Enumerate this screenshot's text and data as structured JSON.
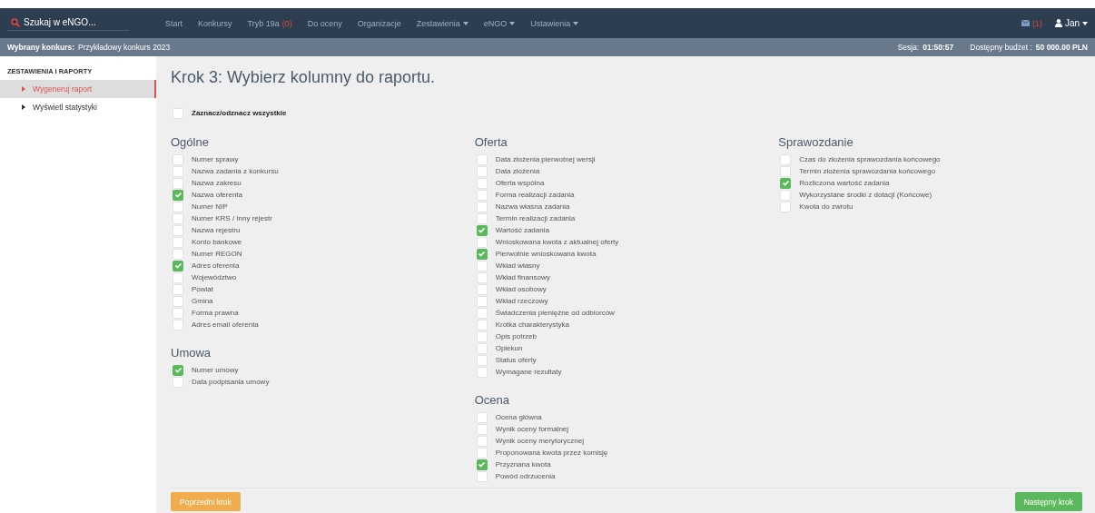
{
  "navbar": {
    "search": {
      "placeholder": "Szukaj w eNGO..."
    },
    "items": [
      {
        "label": "Start",
        "dropdown": false
      },
      {
        "label": "Konkursy",
        "dropdown": false
      },
      {
        "label": "Tryb 19a",
        "count": "(0)",
        "dropdown": false
      },
      {
        "label": "Do oceny",
        "dropdown": false
      },
      {
        "label": "Organizacje",
        "dropdown": false
      },
      {
        "label": "Zestawienia",
        "dropdown": true
      },
      {
        "label": "eNGO",
        "dropdown": true
      },
      {
        "label": "Ustawienia",
        "dropdown": true
      }
    ],
    "messages": {
      "count": "(1)"
    },
    "user": {
      "label": "Jan",
      "dropdown": true
    }
  },
  "context_bar": {
    "contest_label": "Wybrany konkurs:",
    "contest": "Przykładowy konkurs 2023",
    "session_label": "Sesja:",
    "session": "01:50:57",
    "budget_label": "Dostępny budżet :",
    "budget": "50 000.00 PLN"
  },
  "sidebar": {
    "heading": "ZESTAWIENIA I RAPORTY",
    "items": [
      {
        "label": "Wygeneruj raport",
        "selected": true
      },
      {
        "label": "Wyświetl statystyki",
        "selected": false
      }
    ]
  },
  "page": {
    "title": "Krok 3: Wybierz kolumny do raportu.",
    "select_all": {
      "label": "Zaznacz/odznacz wszystkie",
      "checked": false
    },
    "columns": [
      [
        {
          "title": "Ogólne",
          "options": [
            {
              "label": "Numer sprawy",
              "checked": false
            },
            {
              "label": "Nazwa zadania z konkursu",
              "checked": false
            },
            {
              "label": "Nazwa zakresu",
              "checked": false
            },
            {
              "label": "Nazwa oferenta",
              "checked": true
            },
            {
              "label": "Numer NIP",
              "checked": false
            },
            {
              "label": "Numer KRS / Inny rejestr",
              "checked": false
            },
            {
              "label": "Nazwa rejestru",
              "checked": false
            },
            {
              "label": "Konto bankowe",
              "checked": false
            },
            {
              "label": "Numer REGON",
              "checked": false
            },
            {
              "label": "Adres oferenta",
              "checked": true
            },
            {
              "label": "Województwo",
              "checked": false
            },
            {
              "label": "Powiat",
              "checked": false
            },
            {
              "label": "Gmina",
              "checked": false
            },
            {
              "label": "Forma prawna",
              "checked": false
            },
            {
              "label": "Adres email oferenta",
              "checked": false
            }
          ]
        },
        {
          "title": "Umowa",
          "options": [
            {
              "label": "Numer umowy",
              "checked": true
            },
            {
              "label": "Data podpisania umowy",
              "checked": false
            }
          ]
        }
      ],
      [
        {
          "title": "Oferta",
          "options": [
            {
              "label": "Data złożenia pierwotnej wersji",
              "checked": false
            },
            {
              "label": "Data złożenia",
              "checked": false
            },
            {
              "label": "Oferta wspólna",
              "checked": false
            },
            {
              "label": "Forma realizacji zadania",
              "checked": false
            },
            {
              "label": "Nazwa własna zadania",
              "checked": false
            },
            {
              "label": "Termin realizacji zadania",
              "checked": false
            },
            {
              "label": "Wartość zadania",
              "checked": true
            },
            {
              "label": "Wnioskowana kwota z aktualnej oferty",
              "checked": false
            },
            {
              "label": "Pierwotnie wnioskowana kwota",
              "checked": true
            },
            {
              "label": "Wkład własny",
              "checked": false
            },
            {
              "label": "Wkład finansowy",
              "checked": false
            },
            {
              "label": "Wkład osobowy",
              "checked": false
            },
            {
              "label": "Wkład rzeczowy",
              "checked": false
            },
            {
              "label": "Świadczenia pieniężne od odbiorców",
              "checked": false
            },
            {
              "label": "Krótka charakterystyka",
              "checked": false
            },
            {
              "label": "Opis potrzeb",
              "checked": false
            },
            {
              "label": "Opiekun",
              "checked": false
            },
            {
              "label": "Status oferty",
              "checked": false
            },
            {
              "label": "Wymagane rezultaty",
              "checked": false
            }
          ]
        },
        {
          "title": "Ocena",
          "options": [
            {
              "label": "Ocena główna",
              "checked": false
            },
            {
              "label": "Wynik oceny formalnej",
              "checked": false
            },
            {
              "label": "Wynik oceny merytorycznej",
              "checked": false
            },
            {
              "label": "Proponowana kwota przez komisję",
              "checked": false
            },
            {
              "label": "Przyznana kwota",
              "checked": true
            },
            {
              "label": "Powód odrzucenia",
              "checked": false
            }
          ]
        }
      ],
      [
        {
          "title": "Sprawozdanie",
          "options": [
            {
              "label": "Czas do złożenia sprawozdania końcowego",
              "checked": false
            },
            {
              "label": "Termin złożenia sprawozdania końcowego",
              "checked": false
            },
            {
              "label": "Rozliczona wartość zadania",
              "checked": true
            },
            {
              "label": "Wykorzystane środki z dotacji (Końcowe)",
              "checked": false
            },
            {
              "label": "Kwota do zwrotu",
              "checked": false
            }
          ]
        }
      ]
    ],
    "previous_button": "Poprzedni krok",
    "next_button": "Następny krok"
  }
}
